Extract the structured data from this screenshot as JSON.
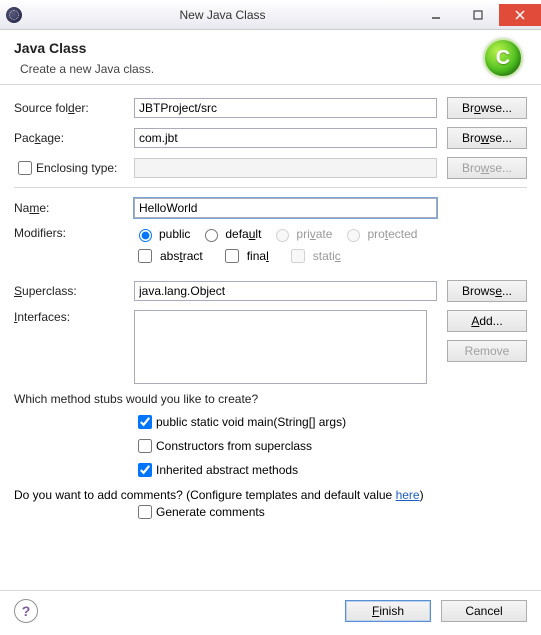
{
  "window": {
    "title": "New Java Class"
  },
  "banner": {
    "heading": "Java Class",
    "sub": "Create a new Java class.",
    "badge": "C"
  },
  "fields": {
    "sourceFolder": {
      "label": "Source folder:",
      "value": "JBTProject/src",
      "browse": "Browse..."
    },
    "package": {
      "label": "Package:",
      "value": "com.jbt",
      "browse": "Browse..."
    },
    "enclosing": {
      "label": "Enclosing type:",
      "value": "",
      "browse": "Browse..."
    },
    "name": {
      "label": "Name:",
      "value": "HelloWorld"
    },
    "modifiers": {
      "label": "Modifiers:",
      "public": "public",
      "default": "default",
      "private": "private",
      "protected": "protected",
      "abstract": "abstract",
      "final": "final",
      "static": "static"
    },
    "superclass": {
      "label": "Superclass:",
      "value": "java.lang.Object",
      "browse": "Browse..."
    },
    "interfaces": {
      "label": "Interfaces:",
      "add": "Add...",
      "remove": "Remove"
    }
  },
  "stubs": {
    "question": "Which method stubs would you like to create?",
    "main": "public static void main(String[] args)",
    "constructors": "Constructors from superclass",
    "inherited": "Inherited abstract methods"
  },
  "comments": {
    "question_pre": "Do you want to add comments? (Configure templates and default value ",
    "link": "here",
    "question_post": ")",
    "generate": "Generate comments"
  },
  "footer": {
    "finish": "Finish",
    "cancel": "Cancel"
  }
}
